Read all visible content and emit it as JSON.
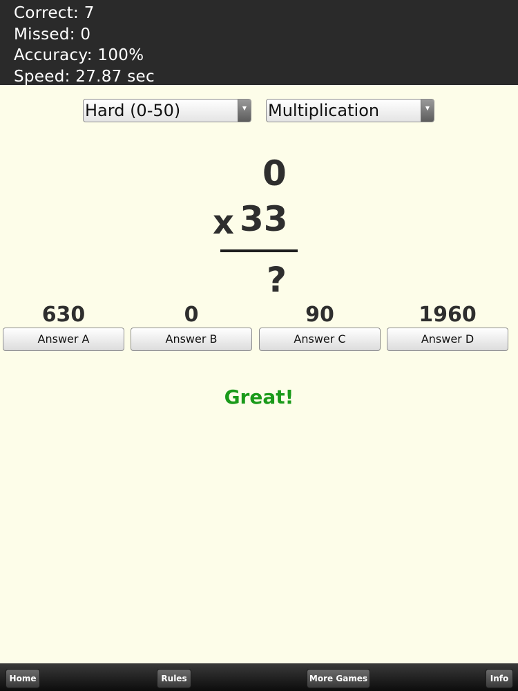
{
  "stats": {
    "correct": "Correct: 7",
    "missed": "Missed: 0",
    "accuracy": "Accuracy: 100%",
    "speed": "Speed: 27.87 sec"
  },
  "selectors": {
    "difficulty": "Hard (0-50)",
    "operation": "Multiplication",
    "arrow_icon": "▼"
  },
  "problem": {
    "top_number": "0",
    "operator": "x",
    "bottom_number": "33",
    "unknown": "?"
  },
  "answers": [
    {
      "value": "630",
      "label": "Answer A"
    },
    {
      "value": "0",
      "label": "Answer B"
    },
    {
      "value": "90",
      "label": "Answer C"
    },
    {
      "value": "1960",
      "label": "Answer D"
    }
  ],
  "feedback": "Great!",
  "nav": {
    "home": "Home",
    "rules": "Rules",
    "more_games": "More Games",
    "info": "Info"
  },
  "colors": {
    "background": "#fdfde9",
    "header": "#2a2a2a",
    "feedback_green": "#1a9a1a"
  }
}
